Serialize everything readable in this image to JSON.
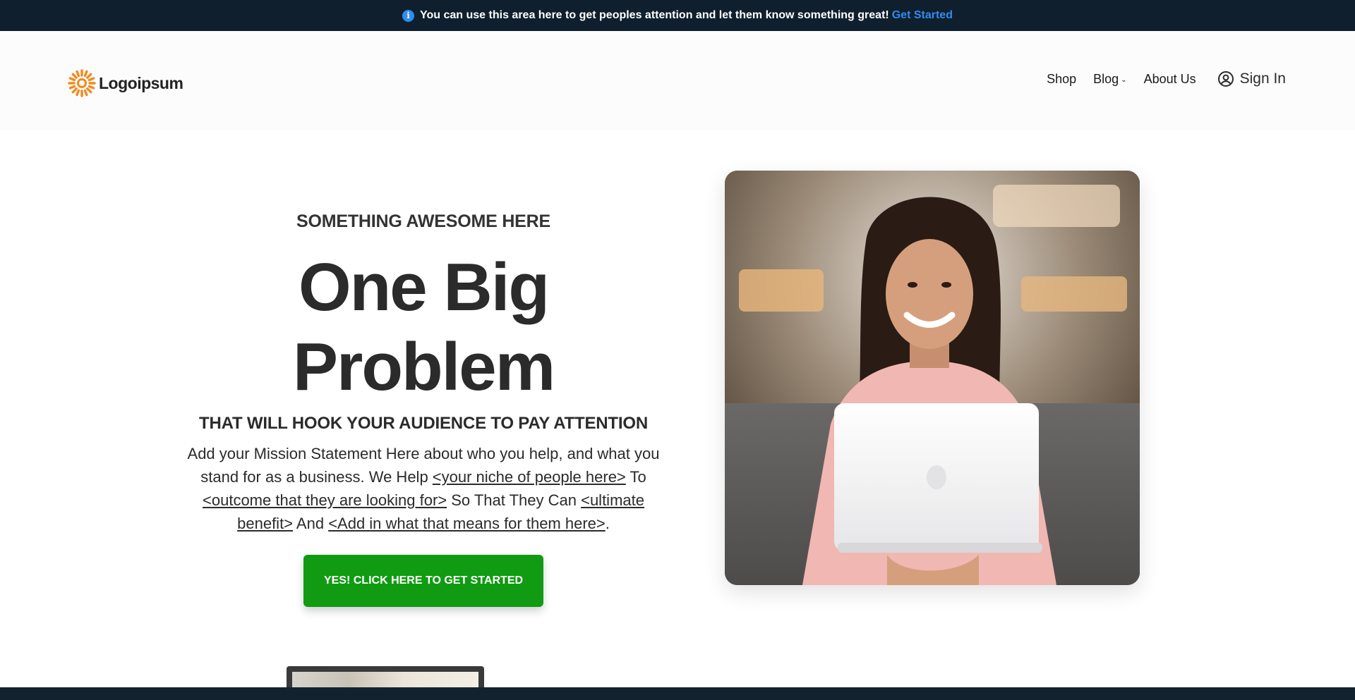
{
  "announcement": {
    "icon": "info-icon",
    "text": "You can use this area here to get peoples attention and let them know something great!",
    "link_label": "Get Started",
    "link_color": "#2f8cf0",
    "background": "#0f1f2e"
  },
  "header": {
    "logo_text": "Logoipsum",
    "nav": [
      {
        "label": "Shop"
      },
      {
        "label": "Blog"
      },
      {
        "label": "About Us"
      }
    ],
    "signin_label": "Sign In"
  },
  "hero": {
    "kicker": "SOMETHING AWESOME HERE",
    "headline_line1": "One Big",
    "headline_line2": "Problem",
    "subhead": "THAT WILL HOOK YOUR AUDIENCE TO PAY ATTENTION",
    "mission": {
      "part1": "Add your Mission Statement Here about who you help, and what you stand for as a business. We Help ",
      "link1": "<your niche of people here>",
      "part2": " To ",
      "link2": "<outcome that they are looking for>",
      "part3": " So That They Can ",
      "link3": "<ultimate benefit>",
      "part4": " And ",
      "link4": "<Add in what that means for them here>",
      "part5": "."
    },
    "cta_label": "YES! CLICK HERE TO GET STARTED",
    "cta_color": "#119b13"
  },
  "colors": {
    "brand_orange": "#f28a1e",
    "dark_navy": "#13222f"
  }
}
